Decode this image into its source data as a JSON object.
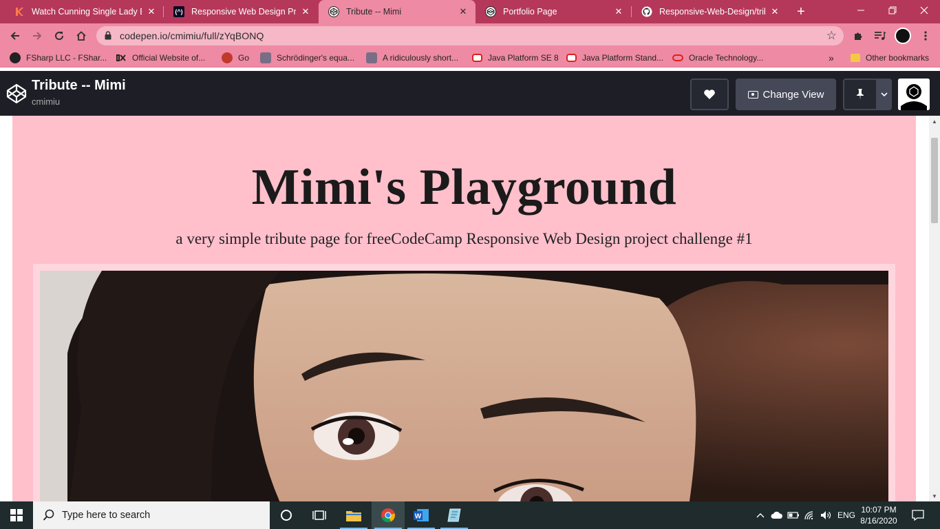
{
  "browser": {
    "tabs": [
      {
        "title": "Watch Cunning Single Lady Ep",
        "icon": "k-favicon"
      },
      {
        "title": "Responsive Web Design Projec",
        "icon": "freecodecamp-favicon"
      },
      {
        "title": "Tribute -- Mimi",
        "icon": "codepen-favicon",
        "active": true
      },
      {
        "title": "Portfolio Page",
        "icon": "codepen-favicon"
      },
      {
        "title": "Responsive-Web-Design/tribut",
        "icon": "github-favicon"
      }
    ],
    "url": "codepen.io/cmimiu/full/zYqBONQ",
    "bookmarks": [
      {
        "label": "FSharp LLC - FShar..."
      },
      {
        "label": "Official Website of..."
      },
      {
        "label": "Go"
      },
      {
        "label": "Schrödinger's equa..."
      },
      {
        "label": "A ridiculously short..."
      },
      {
        "label": "Java Platform SE 8"
      },
      {
        "label": "Java Platform Stand..."
      },
      {
        "label": "Oracle Technology..."
      }
    ],
    "bookmarks_overflow": "»",
    "other_bookmarks": "Other bookmarks",
    "colors": {
      "tabstrip": "#b5385a",
      "toolbar": "#ee8aa3"
    }
  },
  "codepen": {
    "pen_title": "Tribute -- Mimi",
    "author": "cmimiu",
    "change_view_label": "Change View"
  },
  "page": {
    "title": "Mimi's Playground",
    "subtitle": "a very simple tribute page for freeCodeCamp Responsive Web Design project challenge #1",
    "background": "#ffbfcb"
  },
  "taskbar": {
    "search_placeholder": "Type here to search",
    "language": "ENG",
    "time": "10:07 PM",
    "date": "8/16/2020"
  }
}
